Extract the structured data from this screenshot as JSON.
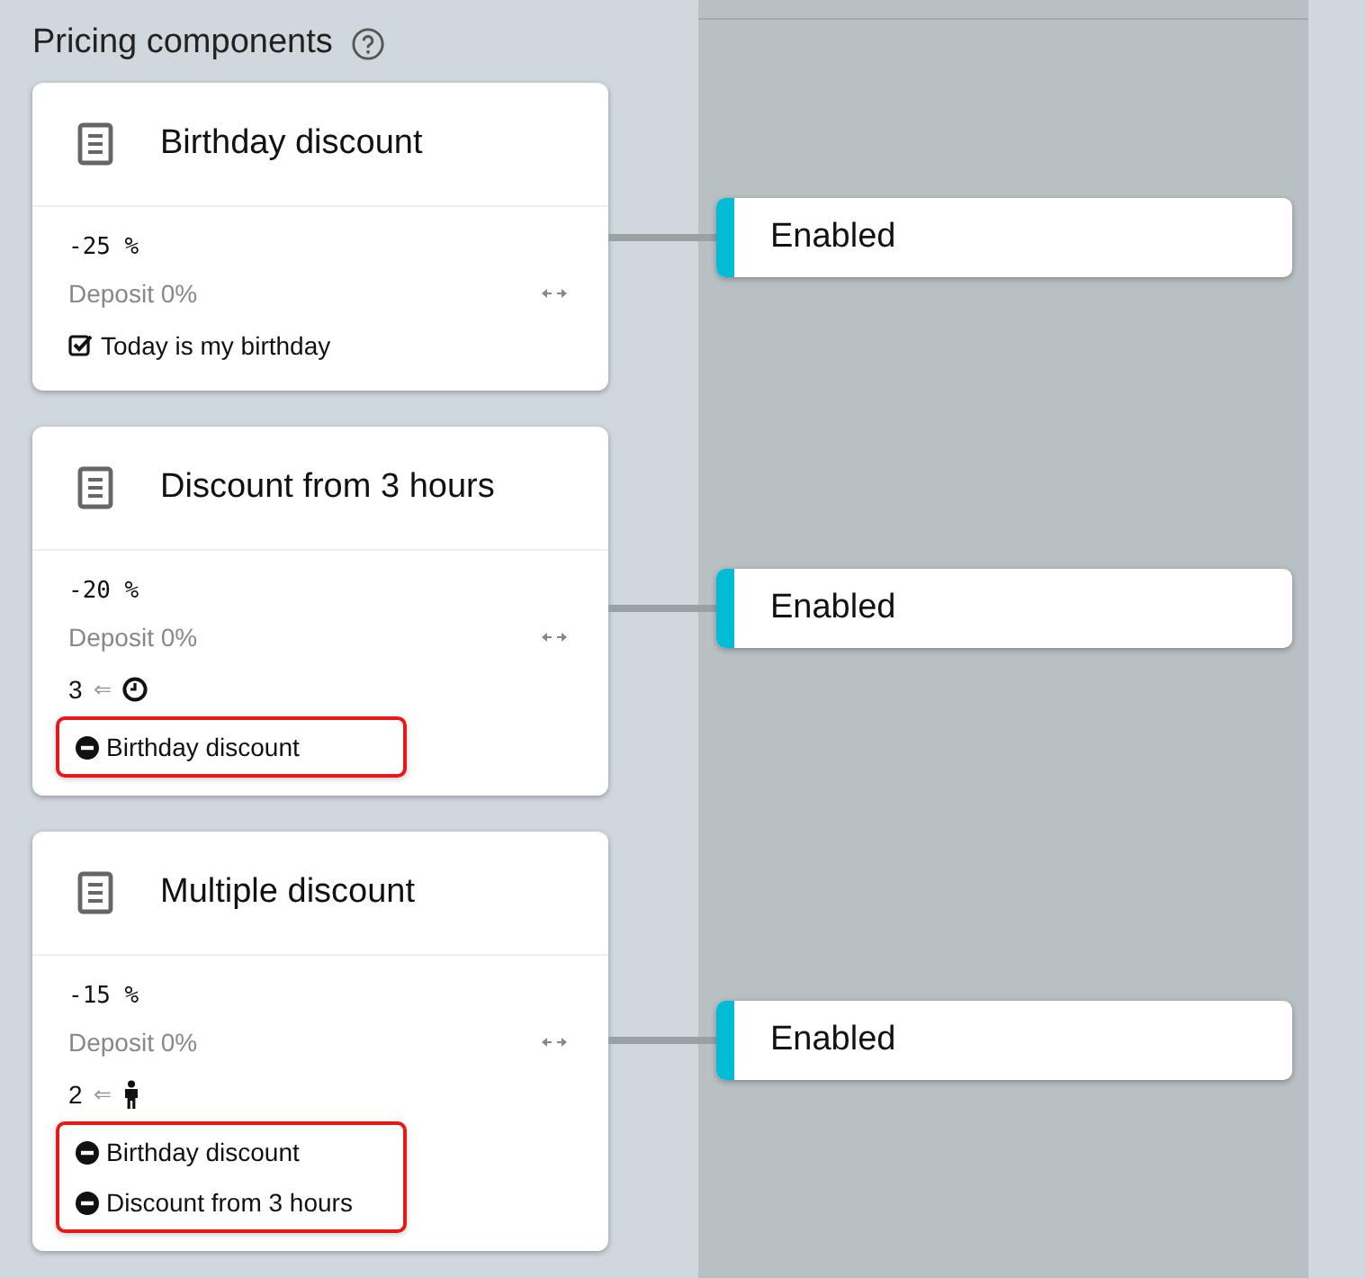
{
  "title": "Pricing components",
  "components": [
    {
      "title": "Birthday discount",
      "amount": "-25 %",
      "deposit": "Deposit 0%",
      "condition": {
        "kind": "checkbox",
        "label": "Today is my birthday",
        "checked": true
      },
      "status": {
        "label": "Enabled",
        "color": "#00bcd4"
      }
    },
    {
      "title": "Discount from 3 hours",
      "amount": "-20 %",
      "deposit": "Deposit 0%",
      "condition": {
        "kind": "hours",
        "value": "3",
        "arrow": "⇐"
      },
      "exclusions": [
        "Birthday discount"
      ],
      "status": {
        "label": "Enabled",
        "color": "#00bcd4"
      }
    },
    {
      "title": "Multiple discount",
      "amount": "-15 %",
      "deposit": "Deposit 0%",
      "condition": {
        "kind": "persons",
        "value": "2",
        "arrow": "⇐"
      },
      "exclusions": [
        "Birthday discount",
        "Discount from 3 hours"
      ],
      "status": {
        "label": "Enabled",
        "color": "#00bcd4"
      }
    }
  ]
}
